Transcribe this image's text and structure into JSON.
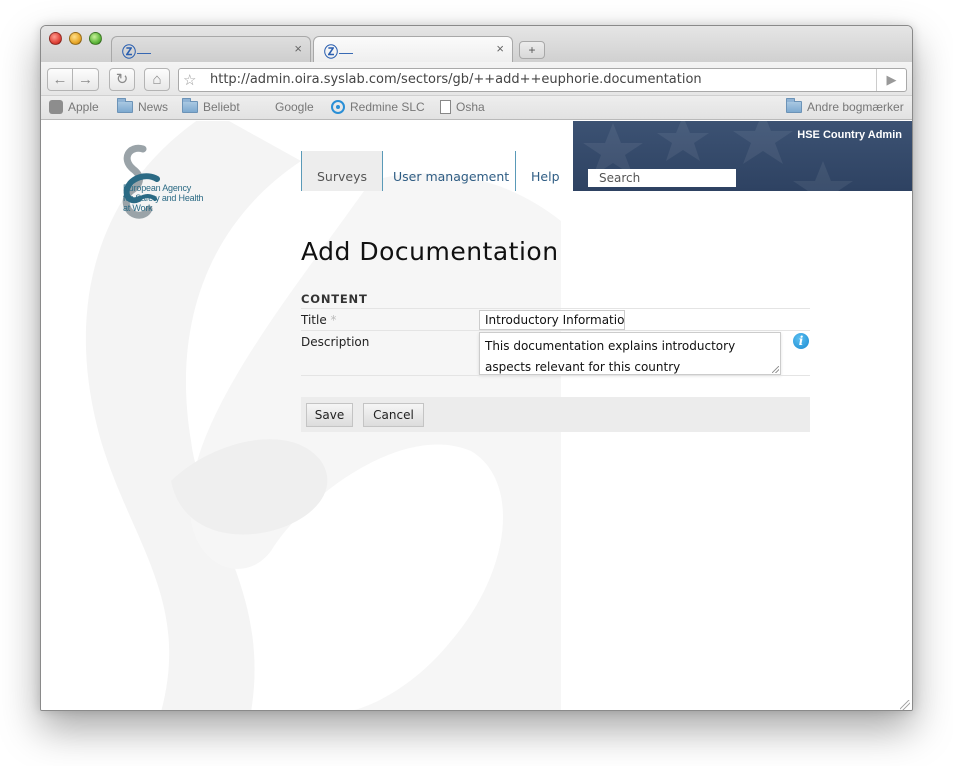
{
  "browser": {
    "tabs": [
      {
        "label": "",
        "close": "×"
      },
      {
        "label": "",
        "close": "×"
      }
    ],
    "new_tab_glyph": "+",
    "url": "http://admin.oira.syslab.com/sectors/gb/++add++euphorie.documentation",
    "bookmarks": [
      "Apple",
      "News",
      "Beliebt",
      "Google",
      "Redmine SLC",
      "Osha"
    ],
    "other_bookmarks": "Andre bogmærker"
  },
  "site": {
    "logo_text": [
      "European Agency",
      "for Safety and Health",
      "at Work"
    ],
    "user_name": "HSE Country Admin",
    "search_placeholder": "Search",
    "nav": [
      "Surveys",
      "User management",
      "Help"
    ],
    "nav_selected": "Surveys"
  },
  "form": {
    "heading": "Add Documentation",
    "section": "CONTENT",
    "title_label": "Title",
    "required_marker": "*",
    "title_value": "Introductory Informatio",
    "description_label": "Description",
    "description_value": "This documentation explains introductory aspects relevant for this country",
    "info_glyph": "i",
    "save_label": "Save",
    "cancel_label": "Cancel"
  },
  "colors": {
    "banner": "#34496a",
    "nav_link": "#2f5d84",
    "info_icon": "#1a8ad0"
  }
}
